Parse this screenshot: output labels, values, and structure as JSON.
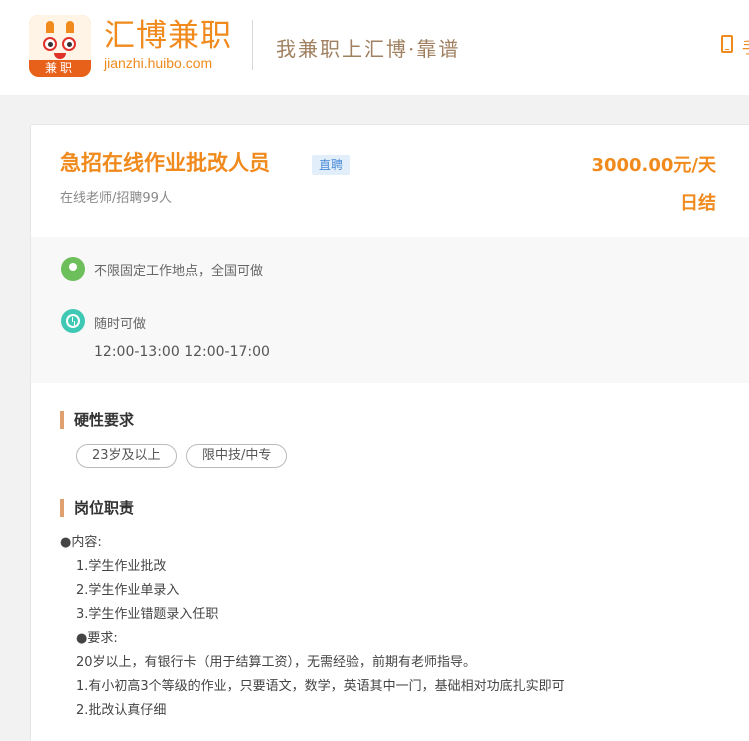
{
  "header": {
    "logo_tag": "兼职",
    "brand_name": "汇博兼职",
    "brand_domain": "jianzhi.huibo.com",
    "slogan": "我兼职上汇博·靠谱",
    "phone_text": "手"
  },
  "job": {
    "title": "急招在线作业批改人员",
    "tag": "直聘",
    "subtitle": "在线老师/招聘99人",
    "salary": "3000.00元/天",
    "settlement": "日结",
    "location": "不限固定工作地点，全国可做",
    "time_label": "随时可做",
    "time_slots": "12:00-13:00 12:00-17:00"
  },
  "requirements": {
    "title": "硬性要求",
    "chips": [
      "23岁及以上",
      "限中技/中专"
    ]
  },
  "duties": {
    "title": "岗位职责",
    "lines": [
      "●内容:",
      "1.学生作业批改",
      "2.学生作业单录入",
      "3.学生作业错题录入任职",
      "●要求:",
      "20岁以上，有银行卡（用于结算工资），无需经验，前期有老师指导。",
      "1.有小初高3个等级的作业，只要语文，数学，英语其中一门，基础相对功底扎实即可",
      "2.批改认真仔细"
    ]
  },
  "colors": {
    "accent": "#f08a1c",
    "tag_blue": "#4a8bd6",
    "location_green": "#6cbf5a",
    "time_teal": "#3fc9b5",
    "section_bar": "#e0a070"
  },
  "icons": {
    "location": "location-pin-icon",
    "time": "clock-icon",
    "phone": "phone-icon"
  }
}
